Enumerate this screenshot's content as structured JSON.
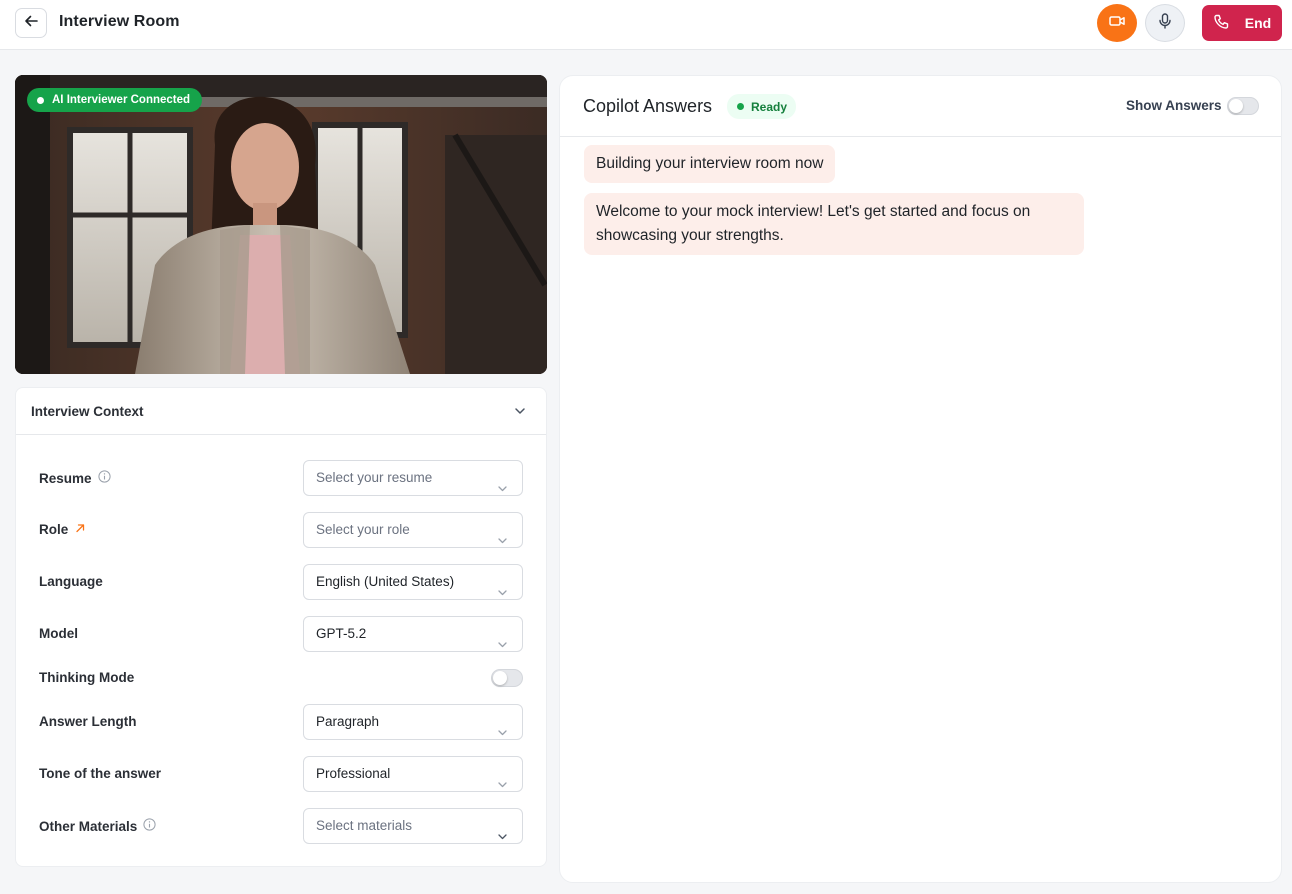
{
  "header": {
    "title": "Interview Room",
    "back_icon": "arrow-left-icon",
    "camera_icon": "video-camera-icon",
    "mic_icon": "microphone-icon",
    "end_label": "End",
    "end_icon": "phone-icon",
    "colors": {
      "camera": "#f97316",
      "end": "#d0244d"
    }
  },
  "video": {
    "status_badge": "AI Interviewer Connected",
    "status_color": "#16a34a"
  },
  "context": {
    "title": "Interview Context",
    "fields": {
      "resume": {
        "label": "Resume",
        "icon": "info-icon",
        "placeholder": "Select your resume"
      },
      "role": {
        "label": "Role",
        "icon": "external-link-arrow-icon",
        "placeholder": "Select your role"
      },
      "language": {
        "label": "Language",
        "value": "English (United States)"
      },
      "model": {
        "label": "Model",
        "value": "GPT-5.2"
      },
      "thinking": {
        "label": "Thinking Mode",
        "enabled": false
      },
      "answer_length": {
        "label": "Answer Length",
        "value": "Paragraph"
      },
      "tone": {
        "label": "Tone of the answer",
        "value": "Professional"
      },
      "materials": {
        "label": "Other Materials",
        "icon": "info-icon",
        "placeholder": "Select materials"
      }
    }
  },
  "copilot": {
    "title": "Copilot Answers",
    "status": "Ready",
    "show_answers_label": "Show Answers",
    "show_answers_enabled": false,
    "messages": [
      "Building your interview room now",
      "Welcome to your mock interview! Let's get started and focus on showcasing your strengths."
    ]
  }
}
